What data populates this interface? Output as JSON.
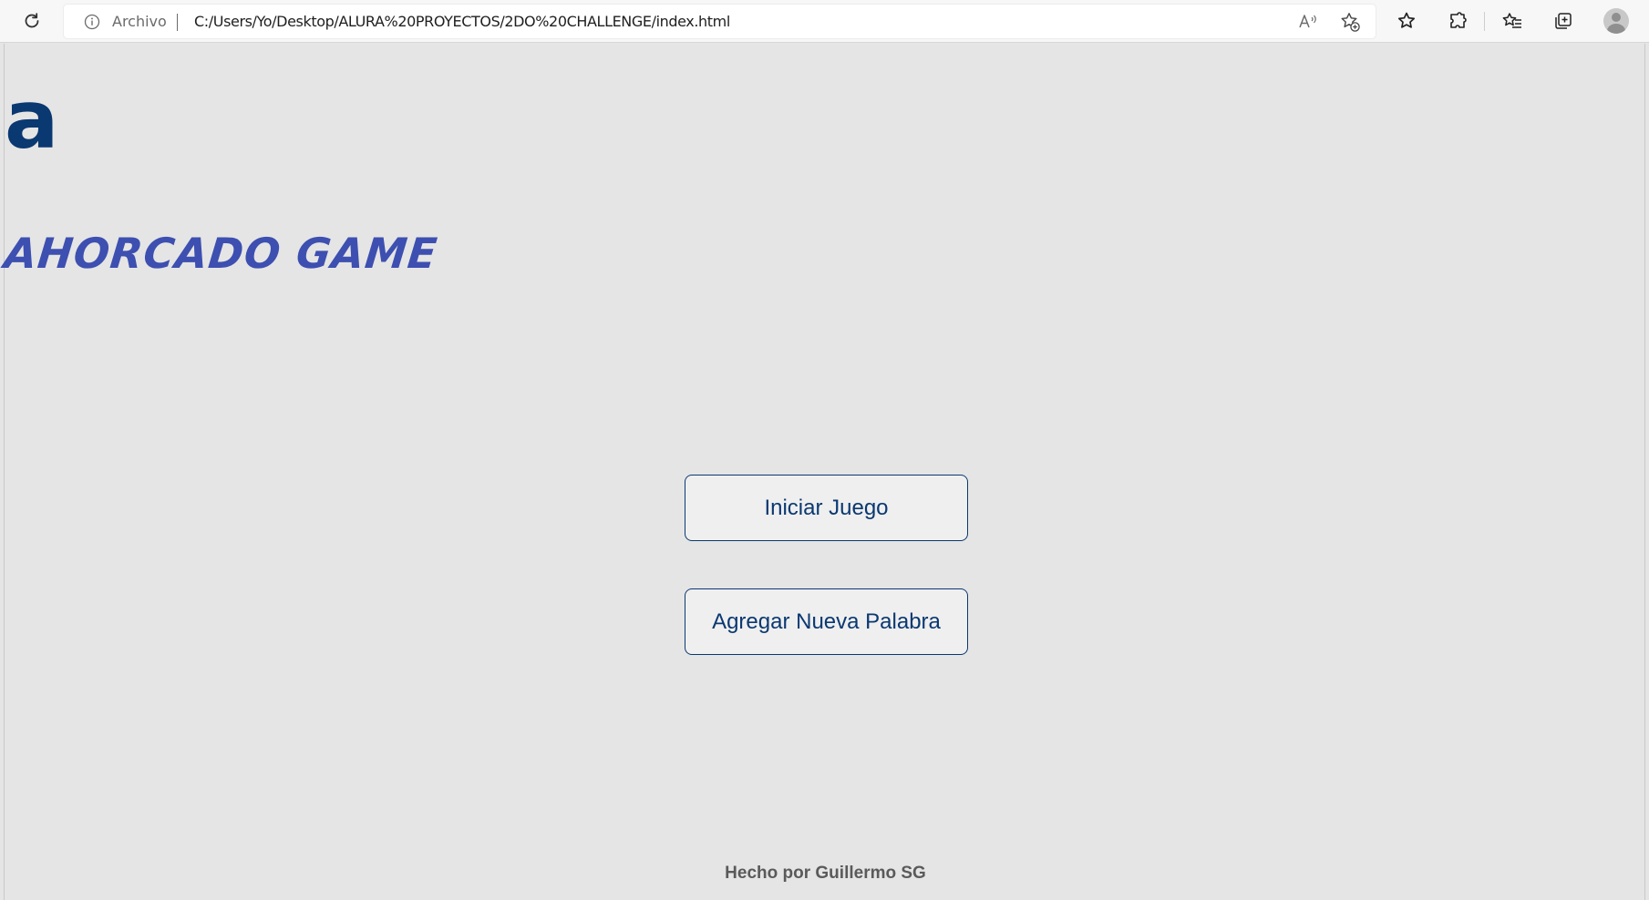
{
  "browser": {
    "address_bar": {
      "scheme_label": "Archivo",
      "url": "C:/Users/Yo/Desktop/ALURA%20PROYECTOS/2DO%20CHALLENGE/index.html"
    },
    "icons": [
      "refresh-icon",
      "info-icon",
      "read-aloud-icon",
      "add-favorite-icon",
      "favorites-star-icon",
      "extensions-icon",
      "favorites-list-icon",
      "collections-icon",
      "profile-avatar-icon"
    ]
  },
  "page": {
    "logo_text": "a",
    "title": "AHORCADO GAME",
    "buttons": {
      "start": "Iniciar Juego",
      "add_word": "Agregar Nueva Palabra"
    },
    "footer": "Hecho por Guillermo SG"
  },
  "colors": {
    "background": "#e5e5e5",
    "brand_dark_blue": "#0a3871",
    "title_blue": "#3d4fb0",
    "footer_gray": "#5a5a5a"
  }
}
